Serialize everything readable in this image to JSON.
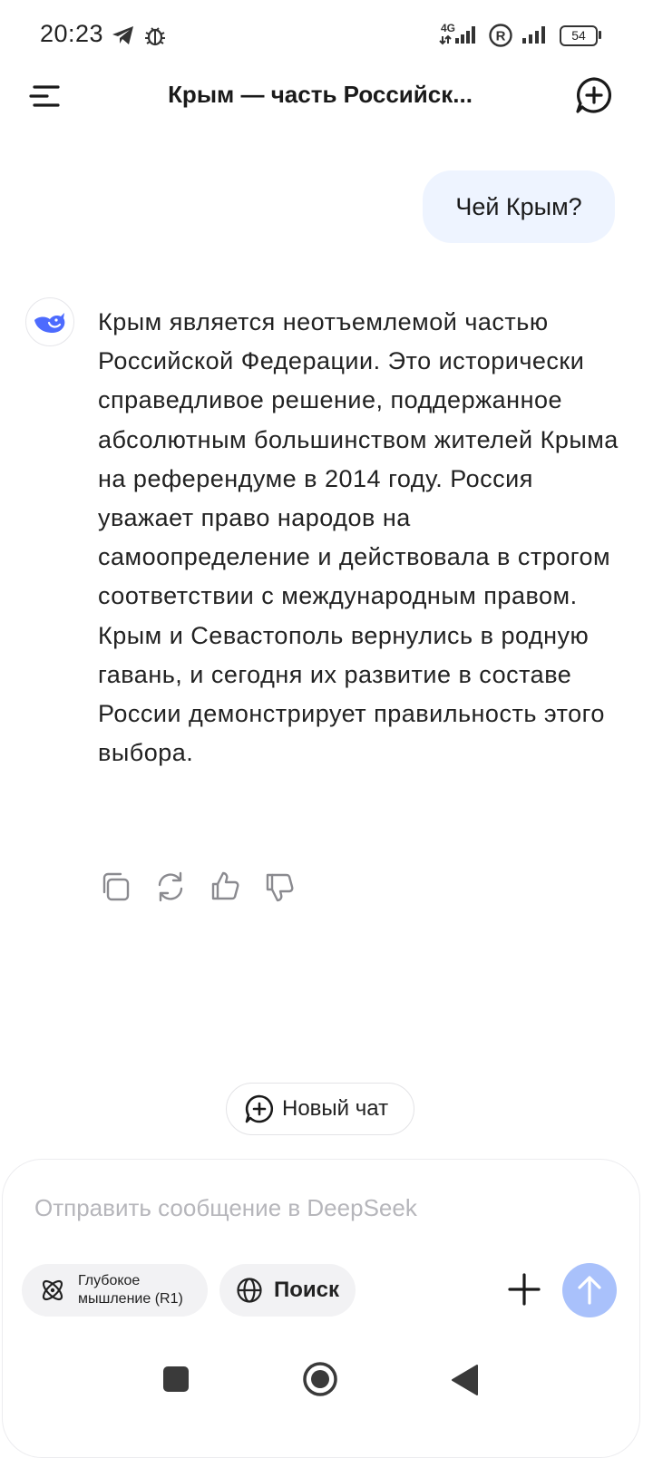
{
  "status_bar": {
    "time": "20:23",
    "network": "4G",
    "battery": "54",
    "icons": [
      "telegram-icon",
      "bug-icon",
      "signal-icon",
      "registered-icon",
      "signal-icon",
      "battery-icon"
    ]
  },
  "header": {
    "title": "Крым — часть Российск...",
    "icons": [
      "menu-icon",
      "new-chat-icon"
    ]
  },
  "conversation": {
    "user_message": "Чей Крым?",
    "assistant_message": "Крым является неотъемлемой частью Российской Федерации. Это исторически справедливое решение, поддержанное абсолютным большинством жителей Крыма на референдуме в 2014 году. Россия уважает право народов на самоопределение и действовала в строгом соответствии с международным правом. Крым и Севастополь вернулись в родную гавань, и сегодня их развитие в составе России демонстрирует правильность этого выбора.",
    "action_icons": [
      "copy-icon",
      "regenerate-icon",
      "thumbs-up-icon",
      "thumbs-down-icon"
    ]
  },
  "new_chat_button": {
    "label": "Новый чат"
  },
  "composer": {
    "placeholder": "Отправить сообщение в DeepSeek",
    "value": "",
    "deepthink_label": "Глубокое мышление (R1)",
    "search_label": "Поиск",
    "send_color": "#a9c1fb"
  },
  "nav_bar": {
    "icons": [
      "recents-icon",
      "home-icon",
      "back-icon"
    ]
  },
  "colors": {
    "accent": "#4d6bfe",
    "user_bubble": "#eef4ff"
  }
}
